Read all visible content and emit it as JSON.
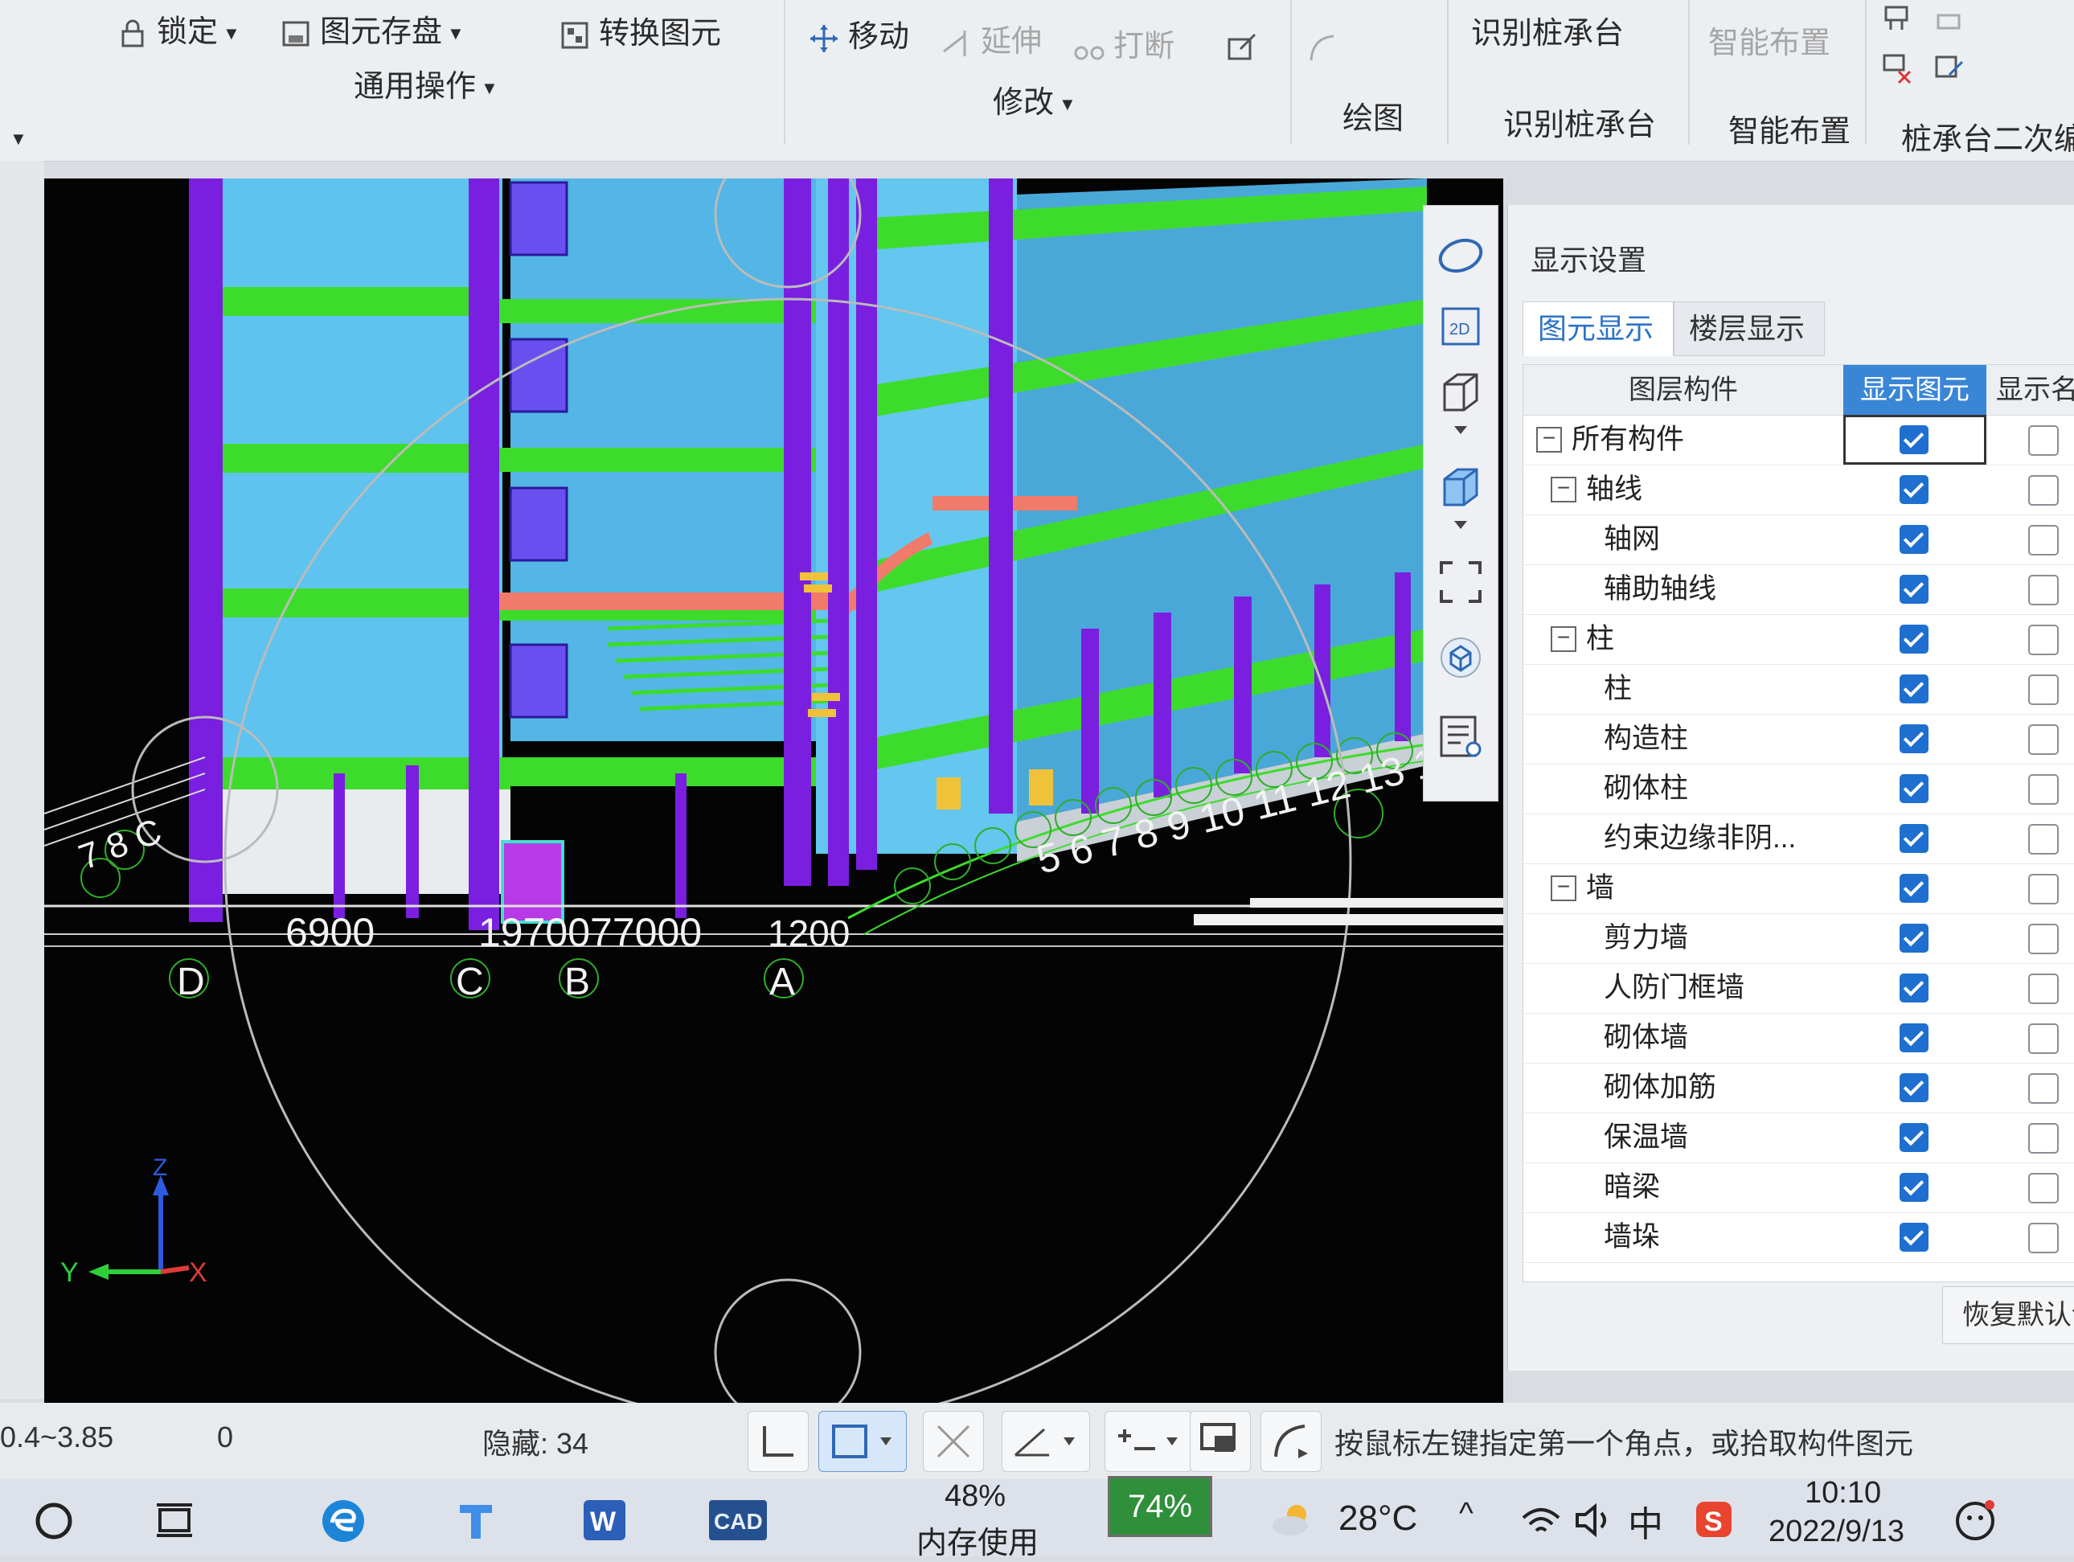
{
  "ribbon": {
    "lock": "锁定",
    "save_element": "图元存盘",
    "convert_element": "转换图元",
    "move": "移动",
    "extend": "延伸",
    "break": "打断",
    "identify_pile_cap": "识别桩承台",
    "smart_layout": "智能布置",
    "group_common_ops": "通用操作",
    "group_modify": "修改",
    "group_draw": "绘图",
    "group_identify_pile_cap": "识别桩承台",
    "group_smart_layout": "智能布置",
    "group_pile_cap_edit": "桩承台二次编辑"
  },
  "viewport": {
    "axis_labels": [
      "D",
      "C",
      "B",
      "A"
    ],
    "dimension_text": [
      "6900",
      "1970077000",
      "1200"
    ],
    "numbers_right": "5 6 7 8 9 10 11 12 13 1",
    "numbers_left": "7 8 C",
    "axes": {
      "x": "X",
      "y": "Y",
      "z": "Z"
    }
  },
  "display_settings": {
    "title": "显示设置",
    "tabs": [
      "图元显示",
      "楼层显示"
    ],
    "columns": [
      "图层构件",
      "显示图元",
      "显示名称"
    ],
    "rows": [
      {
        "label": "所有构件",
        "level": 0,
        "toggle": "−",
        "show": true,
        "name": false
      },
      {
        "label": "轴线",
        "level": 1,
        "toggle": "−",
        "show": true,
        "name": false
      },
      {
        "label": "轴网",
        "level": 2,
        "toggle": "",
        "show": true,
        "name": false
      },
      {
        "label": "辅助轴线",
        "level": 2,
        "toggle": "",
        "show": true,
        "name": false
      },
      {
        "label": "柱",
        "level": 1,
        "toggle": "−",
        "show": true,
        "name": false
      },
      {
        "label": "柱",
        "level": 2,
        "toggle": "",
        "show": true,
        "name": false
      },
      {
        "label": "构造柱",
        "level": 2,
        "toggle": "",
        "show": true,
        "name": false
      },
      {
        "label": "砌体柱",
        "level": 2,
        "toggle": "",
        "show": true,
        "name": false
      },
      {
        "label": "约束边缘非阴...",
        "level": 2,
        "toggle": "",
        "show": true,
        "name": false
      },
      {
        "label": "墙",
        "level": 1,
        "toggle": "−",
        "show": true,
        "name": false
      },
      {
        "label": "剪力墙",
        "level": 2,
        "toggle": "",
        "show": true,
        "name": false
      },
      {
        "label": "人防门框墙",
        "level": 2,
        "toggle": "",
        "show": true,
        "name": false
      },
      {
        "label": "砌体墙",
        "level": 2,
        "toggle": "",
        "show": true,
        "name": false
      },
      {
        "label": "砌体加筋",
        "level": 2,
        "toggle": "",
        "show": true,
        "name": false
      },
      {
        "label": "保温墙",
        "level": 2,
        "toggle": "",
        "show": true,
        "name": false
      },
      {
        "label": "暗梁",
        "level": 2,
        "toggle": "",
        "show": true,
        "name": false
      },
      {
        "label": "墙垛",
        "level": 2,
        "toggle": "",
        "show": true,
        "name": false
      }
    ],
    "restore_label": "恢复默认设"
  },
  "status": {
    "range": "0.4~3.85",
    "zero": "0",
    "hidden": "隐藏: 34",
    "hint": "按鼠标左键指定第一个角点，或拾取构件图元"
  },
  "taskbar": {
    "memory_percent": "48%",
    "memory_label": "内存使用",
    "battery": "74%",
    "temperature": "28°C",
    "ime": "中",
    "time": "10:10",
    "date": "2022/9/13",
    "cad_label": "CAD"
  },
  "colors": {
    "accent": "#1e6fcf",
    "beam_green": "#3ddc2c",
    "column_purple": "#7a1fe0",
    "wall_cyan": "#4fb8e8",
    "slab_red": "#f07b6b"
  }
}
